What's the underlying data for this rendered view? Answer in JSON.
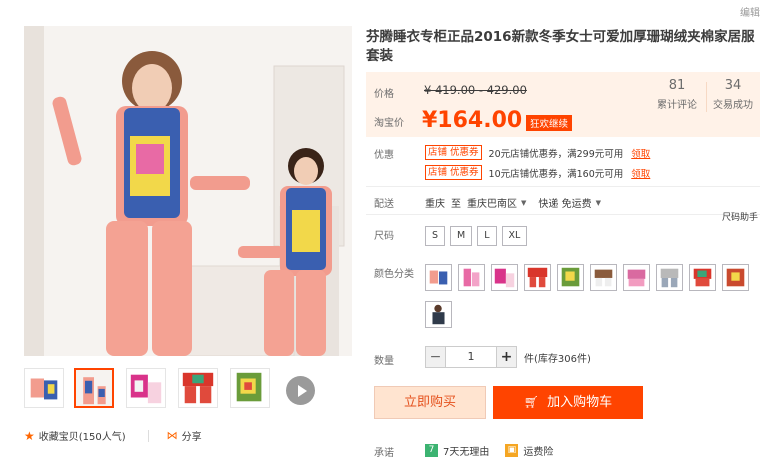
{
  "header": {
    "edit_label": "编辑"
  },
  "product": {
    "title": "芬腾睡衣专柜正品2016新款冬季女士可爱加厚珊瑚绒夹棉家居服套装"
  },
  "price": {
    "price_label": "价格",
    "original_price": "¥ 419.00 - 429.00",
    "promo_label": "淘宝价",
    "promo_price": "¥164.00",
    "promo_tag": "狂欢继续",
    "reviews_count": "81",
    "reviews_label": "累计评论",
    "deals_count": "34",
    "deals_label": "交易成功"
  },
  "coupons": {
    "label": "优惠",
    "items": [
      {
        "tag": "店铺 优惠券",
        "text": "20元店铺优惠券，满299元可用",
        "claim": "领取"
      },
      {
        "tag": "店铺 优惠券",
        "text": "10元店铺优惠券，满160元可用",
        "claim": "领取"
      }
    ]
  },
  "shipping": {
    "label": "配送",
    "origin": "重庆",
    "to": "至",
    "destination": "重庆巴南区",
    "method": "快递 免运费"
  },
  "size": {
    "label": "尺码",
    "helper": "尺码助手",
    "options": [
      "S",
      "M",
      "L",
      "XL"
    ]
  },
  "color": {
    "label": "颜色分类",
    "swatch_count": 11
  },
  "quantity": {
    "label": "数量",
    "minus": "−",
    "value": "1",
    "plus": "+",
    "stock": "件(库存306件)"
  },
  "actions": {
    "buy_now": "立即购买",
    "add_to_cart": "加入购物车"
  },
  "collect": {
    "favorite": "收藏宝贝",
    "popularity": "(150人气)",
    "share": "分享"
  },
  "promise": {
    "label": "承诺",
    "items": [
      {
        "badge": "7",
        "text": "7天无理由"
      },
      {
        "badge": "▣",
        "text": "运费险"
      }
    ]
  },
  "colors": {
    "accent": "#ff4400",
    "price_bg": "#fff2e8",
    "buy_now_bg": "#ffe4d0"
  }
}
